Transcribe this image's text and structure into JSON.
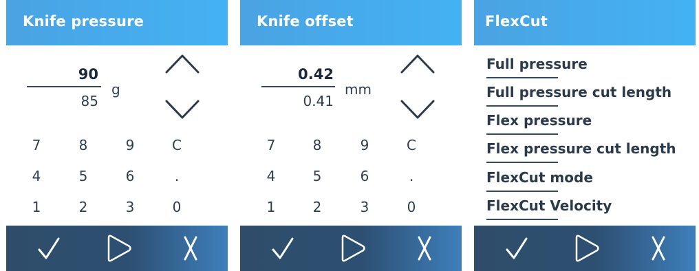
{
  "knife_pressure": {
    "title": "Knife pressure",
    "new_value": "90",
    "current_value": "85",
    "unit": "g",
    "keypad": [
      [
        "7",
        "8",
        "9",
        "C"
      ],
      [
        "4",
        "5",
        "6",
        "."
      ],
      [
        "1",
        "2",
        "3",
        "0"
      ]
    ]
  },
  "knife_offset": {
    "title": "Knife offset",
    "new_value": "0.42",
    "current_value": "0.41",
    "unit": "mm",
    "keypad": [
      [
        "7",
        "8",
        "9",
        "C"
      ],
      [
        "4",
        "5",
        "6",
        "."
      ],
      [
        "1",
        "2",
        "3",
        "0"
      ]
    ]
  },
  "flexcut": {
    "title": "FlexCut",
    "items": [
      "Full pressure",
      "Full pressure cut length",
      "Flex pressure",
      "Flex pressure cut length",
      "FlexCut mode",
      "FlexCut Velocity"
    ]
  },
  "icons": {
    "confirm": "check-icon",
    "next": "play-outline-icon",
    "cancel": "x-icon",
    "increase": "chevron-up-icon",
    "decrease": "chevron-down-icon"
  },
  "colors": {
    "header": "#43b2f4",
    "footer": "#2d4f72",
    "text": "#2b3a4a"
  }
}
